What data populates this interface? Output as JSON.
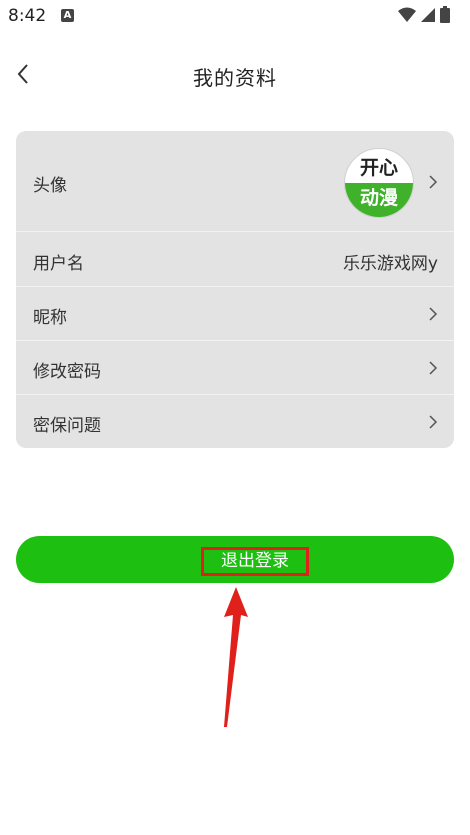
{
  "status_bar": {
    "time": "8:42",
    "notification_icon": "A",
    "icons": [
      "wifi-icon",
      "signal-icon",
      "battery-icon"
    ]
  },
  "header": {
    "title": "我的资料",
    "back_icon": "chevron-left-icon"
  },
  "profile": {
    "avatar": {
      "label": "头像",
      "image_text_top": "开心",
      "image_text_bottom": "动漫"
    },
    "username": {
      "label": "用户名",
      "value": "乐乐游戏网y"
    },
    "nickname": {
      "label": "昵称"
    },
    "change_password": {
      "label": "修改密码"
    },
    "security_question": {
      "label": "密保问题"
    }
  },
  "logout": {
    "label": "退出登录"
  },
  "colors": {
    "accent": "#1dbf10",
    "card_bg": "#e3e3e3",
    "annotation": "#e0201a"
  }
}
